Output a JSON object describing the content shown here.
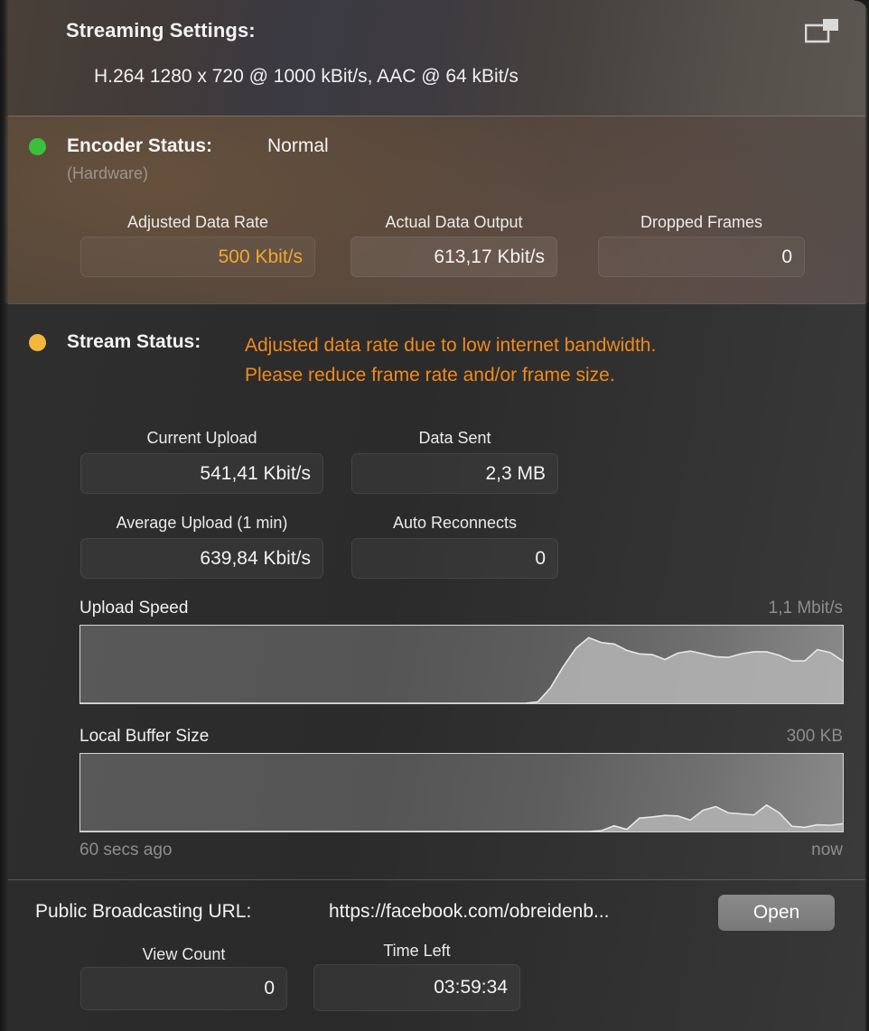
{
  "header": {
    "title": "Streaming Settings:",
    "subtitle": "H.264 1280 x 720 @ 1000 kBit/s, AAC @ 64 kBit/s",
    "pip_icon": "picture-in-picture-icon"
  },
  "encoder": {
    "status_label": "Encoder Status:",
    "status_value": "Normal",
    "status_color": "#3cc03c",
    "hardware_note": "(Hardware)",
    "metrics": [
      {
        "label": "Adjusted Data Rate",
        "value": "500 Kbit/s",
        "warn": true
      },
      {
        "label": "Actual Data Output",
        "value": "613,17 Kbit/s",
        "warn": false
      },
      {
        "label": "Dropped Frames",
        "value": "0",
        "warn": false
      }
    ]
  },
  "stream": {
    "status_label": "Stream Status:",
    "status_color": "#f5b63c",
    "warning_color": "#f08a1e",
    "warning_line1": "Adjusted data rate due to low internet bandwidth.",
    "warning_line2": "Please reduce frame rate and/or frame size.",
    "metrics": [
      {
        "label": "Current Upload",
        "value": "541,41 Kbit/s"
      },
      {
        "label": "Data Sent",
        "value": "2,3 MB"
      },
      {
        "label": "Average Upload (1 min)",
        "value": "639,84 Kbit/s"
      },
      {
        "label": "Auto Reconnects",
        "value": "0"
      }
    ],
    "axis_start": "60 secs ago",
    "axis_end": "now"
  },
  "chart_data": [
    {
      "type": "area",
      "title": "Upload Speed",
      "ylabel": "1,1 Mbit/s",
      "xlabel": "",
      "ylim": [
        0,
        1.1
      ],
      "xlim": [
        -60,
        0
      ],
      "grid": false,
      "legend": "none",
      "x": [
        -60,
        -59,
        -58,
        -57,
        -56,
        -55,
        -54,
        -53,
        -52,
        -51,
        -50,
        -49,
        -48,
        -47,
        -46,
        -45,
        -44,
        -43,
        -42,
        -41,
        -40,
        -39,
        -38,
        -37,
        -36,
        -35,
        -34,
        -33,
        -32,
        -31,
        -30,
        -29,
        -28,
        -27,
        -26,
        -25,
        -24,
        -23,
        -22,
        -21,
        -20,
        -19,
        -18,
        -17,
        -16,
        -15,
        -14,
        -13,
        -12,
        -11,
        -10,
        -9,
        -8,
        -7,
        -6,
        -5,
        -4,
        -3,
        -2,
        -1,
        0
      ],
      "values": [
        0,
        0,
        0,
        0,
        0,
        0,
        0,
        0,
        0,
        0,
        0,
        0,
        0,
        0,
        0,
        0,
        0,
        0,
        0,
        0,
        0,
        0,
        0,
        0,
        0,
        0,
        0,
        0,
        0,
        0,
        0,
        0,
        0,
        0,
        0,
        0,
        0.02,
        0.22,
        0.52,
        0.78,
        0.93,
        0.86,
        0.84,
        0.75,
        0.7,
        0.69,
        0.62,
        0.71,
        0.74,
        0.7,
        0.66,
        0.65,
        0.7,
        0.73,
        0.73,
        0.68,
        0.6,
        0.6,
        0.76,
        0.72,
        0.6
      ]
    },
    {
      "type": "area",
      "title": "Local Buffer Size",
      "ylabel": "300 KB",
      "xlabel": "",
      "ylim": [
        0,
        300
      ],
      "xlim": [
        -60,
        0
      ],
      "grid": false,
      "legend": "none",
      "x": [
        -60,
        -59,
        -58,
        -57,
        -56,
        -55,
        -54,
        -53,
        -52,
        -51,
        -50,
        -49,
        -48,
        -47,
        -46,
        -45,
        -44,
        -43,
        -42,
        -41,
        -40,
        -39,
        -38,
        -37,
        -36,
        -35,
        -34,
        -33,
        -32,
        -31,
        -30,
        -29,
        -28,
        -27,
        -26,
        -25,
        -24,
        -23,
        -22,
        -21,
        -20,
        -19,
        -18,
        -17,
        -16,
        -15,
        -14,
        -13,
        -12,
        -11,
        -10,
        -9,
        -8,
        -7,
        -6,
        -5,
        -4,
        -3,
        -2,
        -1,
        0
      ],
      "values": [
        0,
        0,
        0,
        0,
        0,
        0,
        0,
        0,
        0,
        0,
        0,
        0,
        0,
        0,
        0,
        0,
        0,
        0,
        0,
        0,
        0,
        0,
        0,
        0,
        0,
        0,
        0,
        0,
        0,
        0,
        0,
        0,
        0,
        0,
        0,
        0,
        0,
        0,
        0,
        0,
        0,
        3,
        22,
        8,
        52,
        56,
        62,
        60,
        44,
        82,
        96,
        72,
        68,
        64,
        102,
        72,
        20,
        16,
        26,
        24,
        30
      ]
    }
  ],
  "broadcast": {
    "url_label": "Public Broadcasting URL:",
    "url_value": "https://facebook.com/obreidenb...",
    "open_label": "Open",
    "metrics": [
      {
        "label": "View Count",
        "value": "0"
      },
      {
        "label": "Time Left",
        "value": "03:59:34"
      }
    ]
  }
}
